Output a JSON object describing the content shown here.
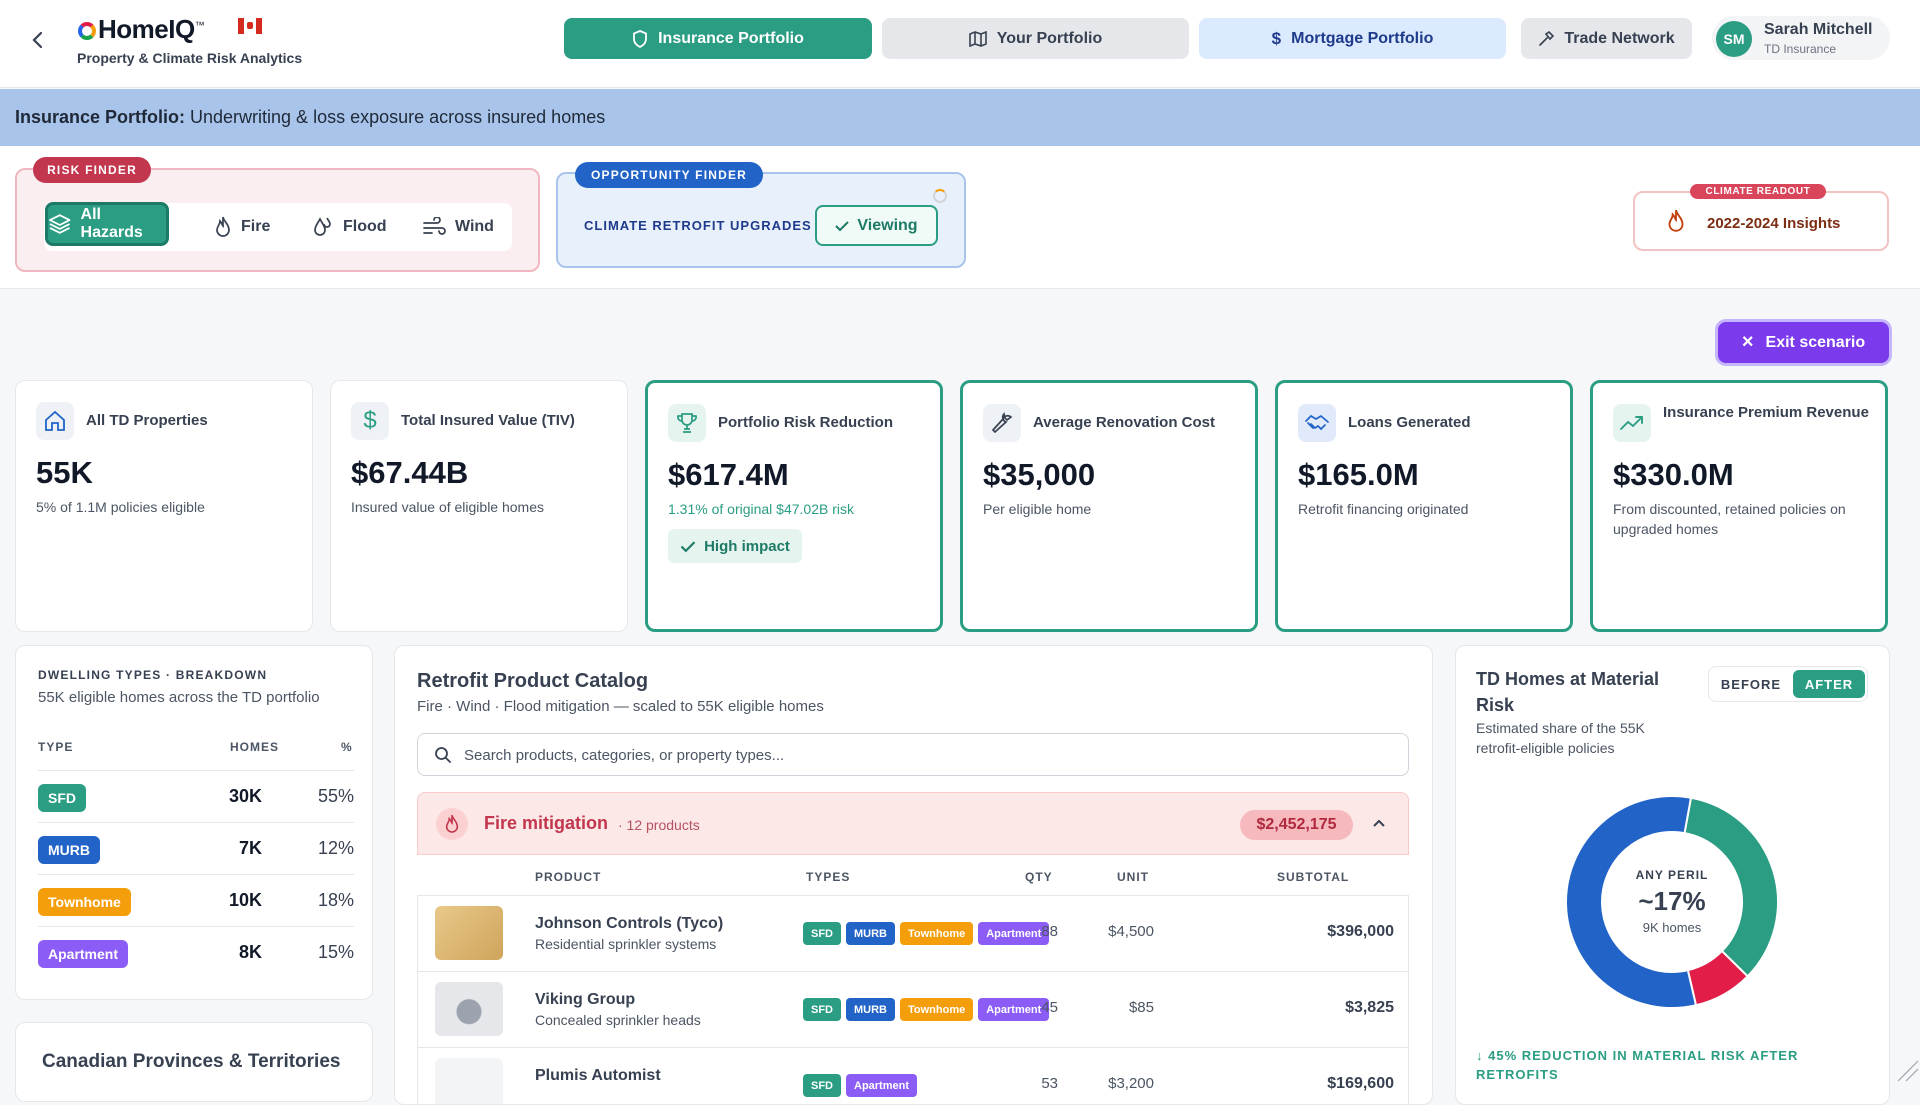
{
  "header": {
    "logo_text": "HomeIQ",
    "subtitle": "Property & Climate Risk Analytics",
    "nav": [
      {
        "label": "Insurance Portfolio"
      },
      {
        "label": "Your Portfolio"
      },
      {
        "label": "Mortgage Portfolio"
      },
      {
        "label": "Trade Network"
      }
    ],
    "user": {
      "initials": "SM",
      "name": "Sarah Mitchell",
      "org": "TD Insurance"
    }
  },
  "banner": {
    "bold": "Insurance Portfolio:",
    "text": " Underwriting & loss exposure across insured homes"
  },
  "risk_finder": {
    "tag": "RISK FINDER",
    "hazards": [
      {
        "label": "All Hazards",
        "active": true
      },
      {
        "label": "Fire"
      },
      {
        "label": "Flood"
      },
      {
        "label": "Wind"
      }
    ]
  },
  "opportunity_finder": {
    "tag": "OPPORTUNITY FINDER",
    "label": "CLIMATE RETROFIT UPGRADES",
    "button": "Viewing"
  },
  "climate_readout": {
    "tag": "CLIMATE READOUT",
    "label": "2022-2024 Insights"
  },
  "exit_button": "Exit scenario",
  "kpis": [
    {
      "label": "All TD Properties",
      "value": "55K",
      "sub": "5% of 1.1M policies eligible",
      "icon": "home-icon"
    },
    {
      "label": "Total Insured Value (TIV)",
      "value": "$67.44B",
      "sub": "Insured value of eligible homes",
      "icon": "dollar-icon"
    },
    {
      "label": "Portfolio Risk Reduction",
      "value": "$617.4M",
      "sub": "1.31% of original $47.02B risk",
      "badge": "High impact",
      "icon": "trophy-icon"
    },
    {
      "label": "Average Renovation Cost",
      "value": "$35,000",
      "sub": "Per eligible home",
      "icon": "wrench-icon"
    },
    {
      "label": "Loans Generated",
      "value": "$165.0M",
      "sub": "Retrofit financing originated",
      "icon": "handshake-icon"
    },
    {
      "label": "Insurance Premium Revenue",
      "value": "$330.0M",
      "sub": "From discounted, retained policies on upgraded homes",
      "icon": "trending-up-icon"
    }
  ],
  "dwelling": {
    "title": "DWELLING TYPES · BREAKDOWN",
    "sub": "55K eligible homes across the TD portfolio",
    "headers": {
      "type": "TYPE",
      "homes": "HOMES",
      "pct": "%"
    },
    "rows": [
      {
        "type": "SFD",
        "homes": "30K",
        "pct": "55%",
        "color": "#2a9d83"
      },
      {
        "type": "MURB",
        "homes": "7K",
        "pct": "12%",
        "color": "#2163c7"
      },
      {
        "type": "Townhome",
        "homes": "10K",
        "pct": "18%",
        "color": "#f59e0b"
      },
      {
        "type": "Apartment",
        "homes": "8K",
        "pct": "15%",
        "color": "#8b5cf6"
      }
    ]
  },
  "provinces": {
    "title": "Canadian Provinces & Territories"
  },
  "catalog": {
    "title": "Retrofit Product Catalog",
    "sub": "Fire · Wind · Flood mitigation — scaled to 55K eligible homes",
    "search_placeholder": "Search products, categories, or property types...",
    "group": {
      "title": "Fire mitigation",
      "count": "· 12 products",
      "total": "$2,452,175"
    },
    "headers": {
      "product": "PRODUCT",
      "types": "TYPES",
      "qty": "QTY",
      "unit": "UNIT",
      "subtotal": "SUBTOTAL"
    },
    "products": [
      {
        "name": "Johnson Controls (Tyco)",
        "desc": "Residential sprinkler systems",
        "types": [
          "SFD",
          "MURB",
          "Townhome",
          "Apartment"
        ],
        "qty": "88",
        "unit": "$4,500",
        "subtotal": "$396,000"
      },
      {
        "name": "Viking Group",
        "desc": "Concealed sprinkler heads",
        "types": [
          "SFD",
          "MURB",
          "Townhome",
          "Apartment"
        ],
        "qty": "45",
        "unit": "$85",
        "subtotal": "$3,825"
      },
      {
        "name": "Plumis Automist",
        "desc": "",
        "types": [
          "SFD",
          "Apartment"
        ],
        "qty": "53",
        "unit": "$3,200",
        "subtotal": "$169,600"
      }
    ]
  },
  "material_risk": {
    "title": "TD Homes at Material Risk",
    "sub": "Estimated share of the 55K retrofit-eligible policies",
    "toggle": {
      "before": "BEFORE",
      "after": "AFTER"
    },
    "donut_label": "ANY PERIL",
    "donut_value": "~17%",
    "donut_sub": "9K homes",
    "segments": [
      {
        "share": 0.345,
        "color": "#2a9d83"
      },
      {
        "share": 0.09,
        "color": "#e11d48"
      },
      {
        "share": 0.565,
        "color": "#2163c7"
      }
    ],
    "reduction": "↓ 45% REDUCTION IN MATERIAL RISK AFTER RETROFITS"
  },
  "colors": {
    "teal": "#2a9d83",
    "blue": "#2163c7",
    "amber": "#f59e0b",
    "purple": "#8b5cf6",
    "red": "#e11d48"
  }
}
